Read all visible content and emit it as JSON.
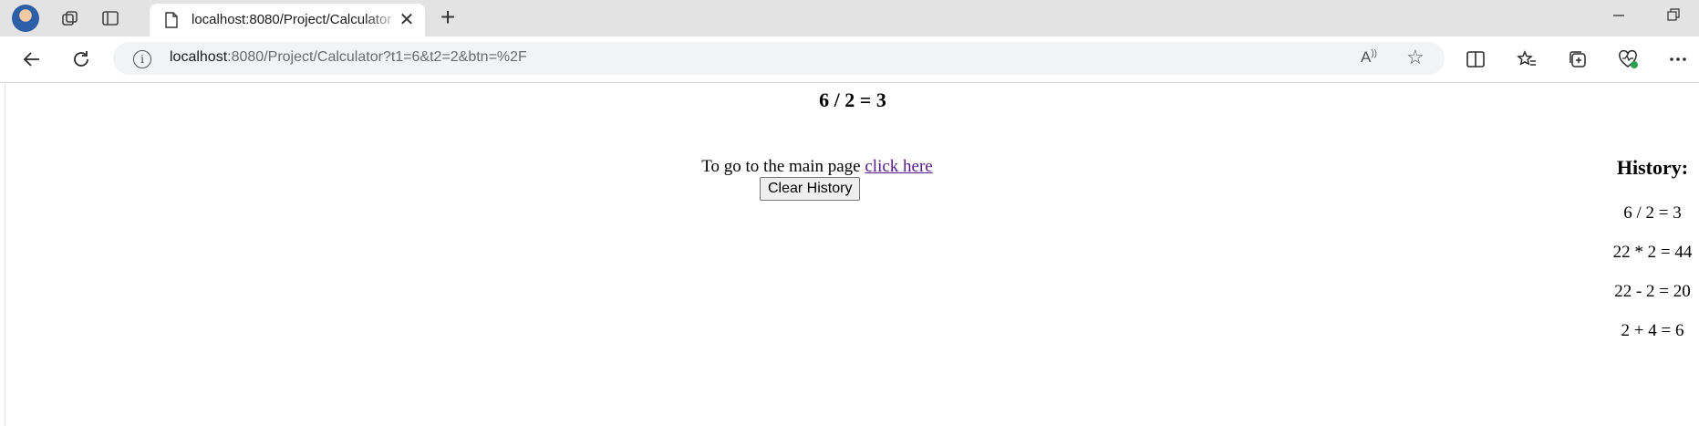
{
  "browser": {
    "tab_title": "localhost:8080/Project/Calculator",
    "url_host": "localhost",
    "url_rest": ":8080/Project/Calculator?t1=6&t2=2&btn=%2F",
    "new_tab": "+",
    "tab_close": "✕"
  },
  "page": {
    "result": "6 / 2 = 3",
    "main_text": "To go to the main page ",
    "link_text": "click here",
    "clear_button": "Clear History",
    "history_title": "History:",
    "history_items": [
      "6 / 2 = 3",
      "22 * 2 = 44",
      "22 - 2 = 20",
      "2 + 4 = 6"
    ]
  },
  "colors": {
    "link": "#551a8b",
    "titlebar": "#e3e3e3",
    "omnibox": "#f1f3f4"
  }
}
